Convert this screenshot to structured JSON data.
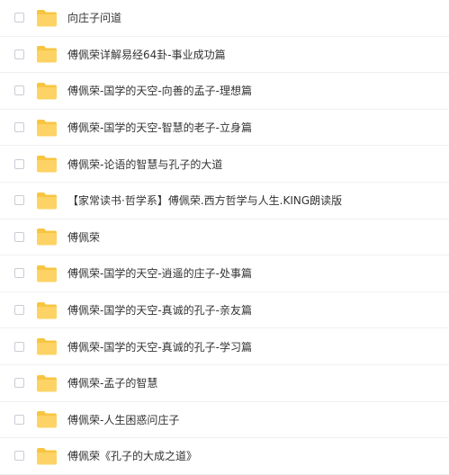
{
  "colors": {
    "folder_body": "#fcd364",
    "folder_tab": "#f8c542",
    "text": "#333333",
    "row_divider": "#eef0f4",
    "checkbox_border": "#c8cdd6"
  },
  "icons": {
    "folder": "folder-icon",
    "checkbox": "checkbox"
  },
  "files": [
    {
      "name": "向庄子问道"
    },
    {
      "name": "傅佩荣详解易经64卦-事业成功篇"
    },
    {
      "name": "傅佩荣-国学的天空-向善的孟子-理想篇"
    },
    {
      "name": "傅佩荣-国学的天空-智慧的老子-立身篇"
    },
    {
      "name": "傅佩荣-论语的智慧与孔子的大道"
    },
    {
      "name": "【家常读书·哲学系】傅佩荣.西方哲学与人生.KING朗读版"
    },
    {
      "name": "傅佩荣"
    },
    {
      "name": "傅佩荣-国学的天空-逍遥的庄子-处事篇"
    },
    {
      "name": "傅佩荣-国学的天空-真诚的孔子-亲友篇"
    },
    {
      "name": "傅佩荣-国学的天空-真诚的孔子-学习篇"
    },
    {
      "name": "傅佩荣-孟子的智慧"
    },
    {
      "name": "傅佩荣-人生困惑问庄子"
    },
    {
      "name": "傅佩荣《孔子的大成之道》"
    }
  ]
}
